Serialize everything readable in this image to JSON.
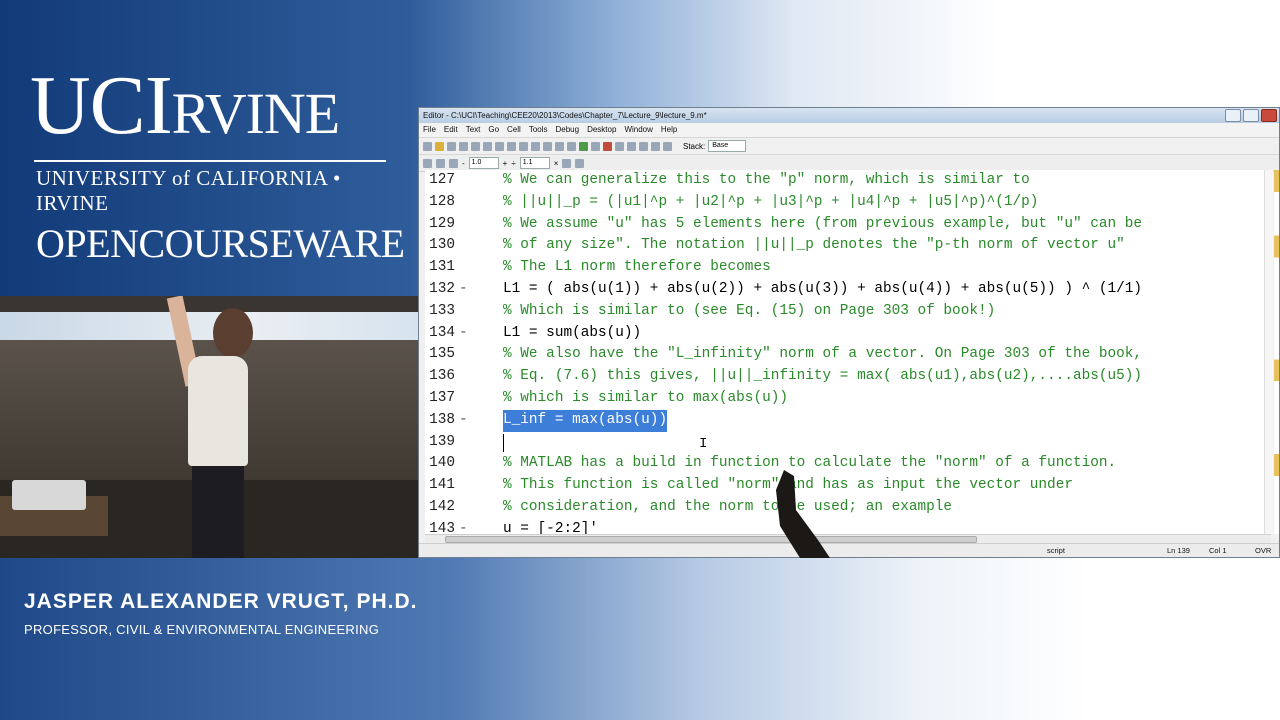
{
  "branding": {
    "uci": "UCI",
    "rvine": "RVINE",
    "university": "UNIVERSITY of CALIFORNIA • IRVINE",
    "ocw": "OPENCOURSEWARE"
  },
  "presenter": {
    "name": "JASPER ALEXANDER VRUGT, PH.D.",
    "title": "PROFESSOR, CIVIL & ENVIRONMENTAL ENGINEERING"
  },
  "editor": {
    "title": "Editor - C:\\UCI\\Teaching\\CEE20\\2013\\Codes\\Chapter_7\\Lecture_9\\lecture_9.m*",
    "menu": [
      "File",
      "Edit",
      "Text",
      "Go",
      "Cell",
      "Tools",
      "Debug",
      "Desktop",
      "Window",
      "Help"
    ],
    "stack_label": "Stack:",
    "stack_value": "Base",
    "cell_minus": "-",
    "cell_value1": "1.0",
    "cell_plus": "+",
    "cell_div": "÷",
    "cell_value2": "1.1",
    "cell_x": "×",
    "lines": [
      {
        "n": "127",
        "dash": "",
        "text": "% We can generalize this to the \"p\" norm, which is similar to",
        "type": "comment"
      },
      {
        "n": "128",
        "dash": "",
        "text": "% ||u||_p = (|u1|^p + |u2|^p + |u3|^p + |u4|^p + |u5|^p)^(1/p)",
        "type": "comment"
      },
      {
        "n": "129",
        "dash": "",
        "text": "% We assume \"u\" has 5 elements here (from previous example, but \"u\" can be",
        "type": "comment"
      },
      {
        "n": "130",
        "dash": "",
        "text": "% of any size\". The notation ||u||_p denotes the \"p-th norm of vector u\"",
        "type": "comment"
      },
      {
        "n": "131",
        "dash": "",
        "text": "% The L1 norm therefore becomes",
        "type": "comment"
      },
      {
        "n": "132",
        "dash": "-",
        "text": "L1 = ( abs(u(1)) + abs(u(2)) + abs(u(3)) + abs(u(4)) + abs(u(5)) ) ^ (1/1)",
        "type": "code"
      },
      {
        "n": "133",
        "dash": "",
        "text": "% Which is similar to (see Eq. (15) on Page 303 of book!)",
        "type": "comment"
      },
      {
        "n": "134",
        "dash": "-",
        "text": "L1 = sum(abs(u))",
        "type": "code"
      },
      {
        "n": "135",
        "dash": "",
        "text": "% We also have the \"L_infinity\" norm of a vector. On Page 303 of the book,",
        "type": "comment"
      },
      {
        "n": "136",
        "dash": "",
        "text": "% Eq. (7.6) this gives, ||u||_infinity = max( abs(u1),abs(u2),....abs(u5))",
        "type": "comment"
      },
      {
        "n": "137",
        "dash": "",
        "text": "% which is similar to max(abs(u))",
        "type": "comment"
      },
      {
        "n": "138",
        "dash": "-",
        "text": "L_inf = max(abs(u))",
        "type": "selected"
      },
      {
        "n": "139",
        "dash": "",
        "text": "",
        "type": "cursor"
      },
      {
        "n": "140",
        "dash": "",
        "text": "% MATLAB has a build in function to calculate the \"norm\" of a function.",
        "type": "comment"
      },
      {
        "n": "141",
        "dash": "",
        "text": "% This function is called \"norm\" and has as input the vector under",
        "type": "comment"
      },
      {
        "n": "142",
        "dash": "",
        "text": "% consideration, and the norm to be used; an example",
        "type": "comment"
      },
      {
        "n": "143",
        "dash": "-",
        "text": "u = [-2:2]'",
        "type": "code"
      }
    ],
    "status": {
      "mode": "script",
      "ln": "Ln  139",
      "col": "Col  1",
      "ovr": "OVR"
    }
  },
  "colors": {
    "comment": "#2a8a2a",
    "selection": "#3d7ed8",
    "brand_blue": "#1d4a86"
  }
}
